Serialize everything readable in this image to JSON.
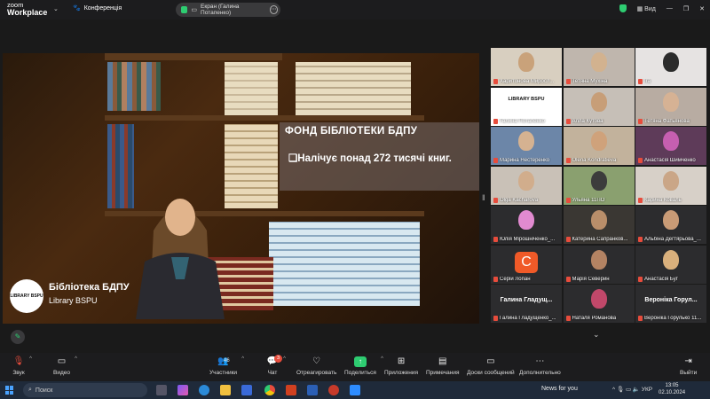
{
  "app": {
    "logo_line1": "zoom",
    "logo_line2": "Workplace",
    "conference_label": "Конференція"
  },
  "share": {
    "label": "Екран (Галина Потапенко)"
  },
  "top_right": {
    "view_label": "Вид"
  },
  "slide": {
    "title": "ФОНД БІБЛІОТЕКИ БДПУ",
    "bullet": "❑Налічує понад 272 тисячі книг.",
    "library_name": "Бібліотека БДПУ",
    "library_sub": "Library BSPU",
    "logo_text": "LIBRARY BSPU"
  },
  "gallery": [
    {
      "name": "Харитонова Миросл...",
      "bg": "#d8cfc0",
      "face": "#c9a27a"
    },
    {
      "name": "Тетяна Мухіна",
      "bg": "#bfb6ad",
      "face": "#d2b28f"
    },
    {
      "name": "Ira",
      "bg": "#e6e3e2",
      "face": "#2b2b2b"
    },
    {
      "name": "Галина Потапенко",
      "bg": "#ffffff",
      "face": "#ffffff",
      "logo": "LIBRARY BSPU",
      "active": true
    },
    {
      "name": "Алла Кутова",
      "bg": "#c6bfb7",
      "face": "#c79e78"
    },
    {
      "name": "Тетяна Фатьянова",
      "bg": "#b8aca2",
      "face": "#d6b294"
    },
    {
      "name": "Марина Нестеренко",
      "bg": "#6c86a8",
      "face": "#d5b291"
    },
    {
      "name": "Olena Kondratieva",
      "bg": "#c2b29c",
      "face": "#cfa27b"
    },
    {
      "name": "Анастасія Шимченко",
      "bg": "#5e3b59",
      "face": "#c65fb0"
    },
    {
      "name": "Olga Kacharova",
      "bg": "#c9c1b7",
      "face": "#d1ad8c"
    },
    {
      "name": "Ульяна 11ПО",
      "bg": "#8aa06f",
      "face": "#3c3c3c"
    },
    {
      "name": "Карина Коваль",
      "bg": "#d7d0c8",
      "face": "#caa687"
    },
    {
      "name": "Юлія Мірошніченко_...",
      "bg": "#2c2c2e",
      "face": "#e18ad0"
    },
    {
      "name": "Катерина Сапранков...",
      "bg": "#3a3733",
      "face": "#b98e6a"
    },
    {
      "name": "Альбіна Дегтярьова_...",
      "bg": "#2c2c2e",
      "face": "#c99b76"
    },
    {
      "name": "Серій Лопан",
      "bg": "#2c2c2e",
      "avatar": "C"
    },
    {
      "name": "Марія Северин",
      "bg": "#2c2c2e",
      "face": "#b38363"
    },
    {
      "name": "Анастасія Буг",
      "bg": "#2c2c2e",
      "face": "#d9b07c"
    },
    {
      "name": "Галина Гладущенко_...",
      "bg": "#2c2c2e",
      "big": "Галина Гладущ..."
    },
    {
      "name": "Наталя Романова",
      "bg": "#2c2c2e",
      "face": "#c1486a"
    },
    {
      "name": "Вероніка Горулько 11...",
      "bg": "#2c2c2e",
      "big": "Вероніка Горул..."
    }
  ],
  "toolbar": {
    "audio": "Звук",
    "video": "Видео",
    "participants": "Участники",
    "participants_count": "46",
    "chat": "Чат",
    "chat_badge": "3",
    "react": "Отреагировать",
    "share": "Поделиться",
    "apps": "Приложения",
    "notes": "Примечания",
    "whiteboards": "Доски сообщений",
    "more": "Дополнительно",
    "leave": "Выйти"
  },
  "taskbar": {
    "search_placeholder": "Поиск",
    "news": "News for you",
    "lang": "УКР",
    "time": "13:05",
    "date": "02.10.2024"
  },
  "colors": {
    "accent_green": "#2ecc71",
    "mute_red": "#e74c3c",
    "bg_dark": "#1a1a1a"
  }
}
